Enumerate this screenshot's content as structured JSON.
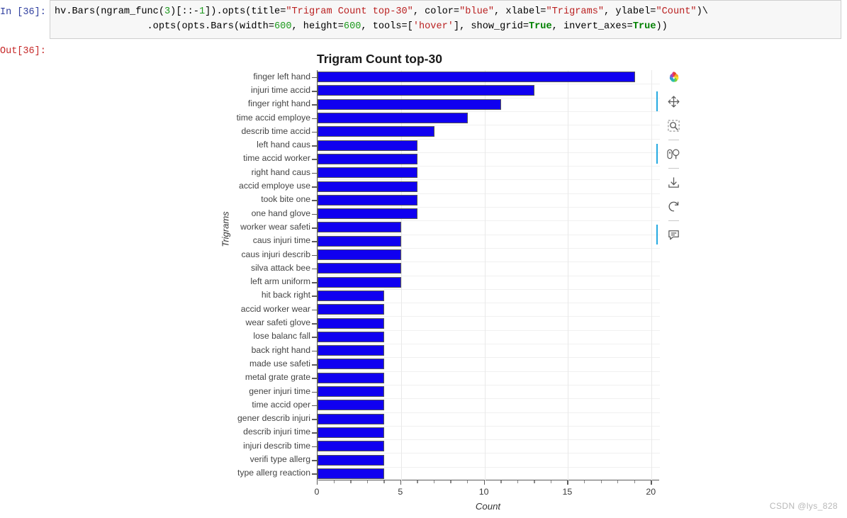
{
  "notebook": {
    "in_prompt": "In [36]:",
    "out_prompt": "Out[36]:",
    "code_line1_a": "hv.Bars(ngram_func(",
    "code_line1_num3": "3",
    "code_line1_b": ")[::-",
    "code_line1_num1": "1",
    "code_line1_c": "]).opts(title=",
    "code_line1_title": "\"Trigram Count top-30\"",
    "code_line1_d": ", color=",
    "code_line1_color": "\"blue\"",
    "code_line1_e": ", xlabel=",
    "code_line1_xlabel": "\"Trigrams\"",
    "code_line1_f": ", ylabel=",
    "code_line1_ylabel": "\"Count\"",
    "code_line1_g": ")\\",
    "code_line2_a": "                .opts(opts.Bars(width=",
    "code_line2_w": "600",
    "code_line2_b": ", height=",
    "code_line2_h": "600",
    "code_line2_c": ", tools=[",
    "code_line2_hover": "'hover'",
    "code_line2_d": "], show_grid=",
    "code_line2_true1": "True",
    "code_line2_e": ", invert_axes=",
    "code_line2_true2": "True",
    "code_line2_f": "))"
  },
  "plot": {
    "title": "Trigram Count top-30",
    "xlabel": "Count",
    "ylabel": "Trigrams",
    "bar_color": "#1000f0",
    "grid": true,
    "xticks": [
      "0",
      "5",
      "10",
      "15",
      "20"
    ],
    "xtick_values": [
      0,
      5,
      10,
      15,
      20
    ]
  },
  "toolbar": {
    "items": [
      {
        "name": "bokeh-logo",
        "label": "Bokeh",
        "active": false
      },
      {
        "name": "pan-tool",
        "label": "Pan",
        "active": true
      },
      {
        "name": "box-zoom-tool",
        "label": "Box Zoom",
        "active": false
      },
      {
        "name": "wheel-zoom-tool",
        "label": "Wheel Zoom",
        "active": true
      },
      {
        "name": "save-tool",
        "label": "Save",
        "active": false
      },
      {
        "name": "reset-tool",
        "label": "Reset",
        "active": false
      },
      {
        "name": "hover-tool",
        "label": "Hover",
        "active": true
      }
    ]
  },
  "watermark": "CSDN @lys_828",
  "chart_data": {
    "type": "bar",
    "orientation": "horizontal",
    "title": "Trigram Count top-30",
    "xlabel": "Count",
    "ylabel": "Trigrams",
    "xlim": [
      0,
      20.5
    ],
    "grid": true,
    "legend": "none",
    "color": "blue",
    "categories": [
      "finger left hand",
      "injuri time accid",
      "finger right hand",
      "time accid employe",
      "describ time accid",
      "left hand caus",
      "time accid worker",
      "right hand caus",
      "accid employe use",
      "took bite one",
      "one hand glove",
      "worker wear safeti",
      "caus injuri time",
      "caus injuri describ",
      "silva attack bee",
      "left arm uniform",
      "hit back right",
      "accid worker wear",
      "wear safeti glove",
      "lose balanc fall",
      "back right hand",
      "made use safeti",
      "metal grate grate",
      "gener injuri time",
      "time accid oper",
      "gener describ injuri",
      "describ injuri time",
      "injuri describ time",
      "verifi type allerg",
      "type allerg reaction"
    ],
    "values": [
      19,
      13,
      11,
      9,
      7,
      6,
      6,
      6,
      6,
      6,
      6,
      5,
      5,
      5,
      5,
      5,
      4,
      4,
      4,
      4,
      4,
      4,
      4,
      4,
      4,
      4,
      4,
      4,
      4,
      4
    ]
  }
}
